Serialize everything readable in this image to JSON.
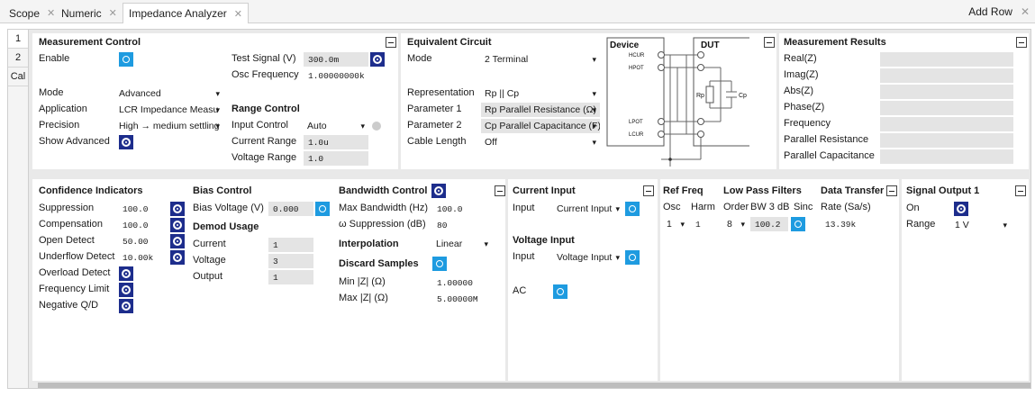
{
  "tabs": [
    {
      "label": "Scope"
    },
    {
      "label": "Numeric"
    },
    {
      "label": "Impedance Analyzer"
    }
  ],
  "add_row": "Add Row",
  "side_tabs": [
    "1",
    "2",
    "Cal"
  ],
  "mc": {
    "title": "Measurement Control",
    "enable": "Enable",
    "test_signal": "Test Signal (V)",
    "test_signal_val": "300.0m",
    "osc_freq": "Osc Frequency",
    "osc_freq_val": "1.00000000k",
    "mode": "Mode",
    "mode_val": "Advanced",
    "application": "Application",
    "application_val": "LCR Impedance Measu",
    "precision": "Precision",
    "precision_val": "High → medium settling",
    "show_adv": "Show Advanced"
  },
  "rc": {
    "title": "Range Control",
    "input_control": "Input Control",
    "input_control_val": "Auto",
    "current_range": "Current Range",
    "current_range_val": "1.0u",
    "voltage_range": "Voltage Range",
    "voltage_range_val": "1.0"
  },
  "ec": {
    "title": "Equivalent Circuit",
    "mode": "Mode",
    "mode_val": "2 Terminal",
    "representation": "Representation",
    "representation_val": "Rp || Cp",
    "param1": "Parameter 1",
    "param1_val": "Rp Parallel Resistance (Ω)",
    "param2": "Parameter 2",
    "param2_val": "Cp Parallel Capacitance (F)",
    "cable": "Cable Length",
    "cable_val": "Off"
  },
  "diagram": {
    "device": "Device",
    "dut": "DUT",
    "hcur": "HCUR",
    "hpot": "HPOT",
    "lpot": "LPOT",
    "lcur": "LCUR",
    "rp": "Rp",
    "cp": "Cp"
  },
  "mr": {
    "title": "Measurement Results",
    "items": [
      "Real(Z)",
      "Imag(Z)",
      "Abs(Z)",
      "Phase(Z)",
      "Frequency",
      "Parallel Resistance",
      "Parallel Capacitance"
    ]
  },
  "ci": {
    "title": "Confidence Indicators",
    "suppression": "Suppression",
    "suppression_val": "100.0",
    "compensation": "Compensation",
    "compensation_val": "100.0",
    "open_detect": "Open Detect",
    "open_detect_val": "50.00",
    "underflow": "Underflow Detect",
    "underflow_val": "10.00k",
    "overload": "Overload Detect",
    "freq_limit": "Frequency Limit",
    "neg_qd": "Negative Q/D"
  },
  "bc": {
    "title": "Bias Control",
    "bias_voltage": "Bias Voltage (V)",
    "bias_voltage_val": "0.000",
    "demod": "Demod Usage",
    "current": "Current",
    "current_val": "1",
    "voltage": "Voltage",
    "voltage_val": "3",
    "output": "Output",
    "output_val": "1"
  },
  "bw": {
    "title": "Bandwidth Control",
    "max_bw": "Max Bandwidth (Hz)",
    "max_bw_val": "100.0",
    "omega": "ω Suppression (dB)",
    "omega_val": "80",
    "interp": "Interpolation",
    "interp_val": "Linear",
    "discard": "Discard Samples",
    "minz": "Min |Z| (Ω)",
    "minz_val": "1.00000",
    "maxz": "Max |Z| (Ω)",
    "maxz_val": "5.00000M"
  },
  "ci2": {
    "title": "Current Input",
    "input": "Input",
    "input_val": "Current Input",
    "vtitle": "Voltage Input",
    "vinput": "Input",
    "vinput_val": "Voltage Input",
    "ac": "AC"
  },
  "rf": {
    "title": "Ref Freq",
    "osc": "Osc",
    "harm": "Harm",
    "osc_val": "1",
    "harm_val": "1"
  },
  "lp": {
    "title": "Low Pass Filters",
    "order": "Order",
    "bw": "BW 3 dB",
    "sinc": "Sinc",
    "order_val": "8",
    "bw_val": "100.2"
  },
  "dt": {
    "title": "Data Transfer",
    "rate": "Rate (Sa/s)",
    "rate_val": "13.39k"
  },
  "so": {
    "title": "Signal Output 1",
    "on": "On",
    "range": "Range",
    "range_val": "1 V"
  },
  "colors": {
    "toggle_on": "#1d2d8c",
    "toggle_off": "#1e9be0"
  }
}
